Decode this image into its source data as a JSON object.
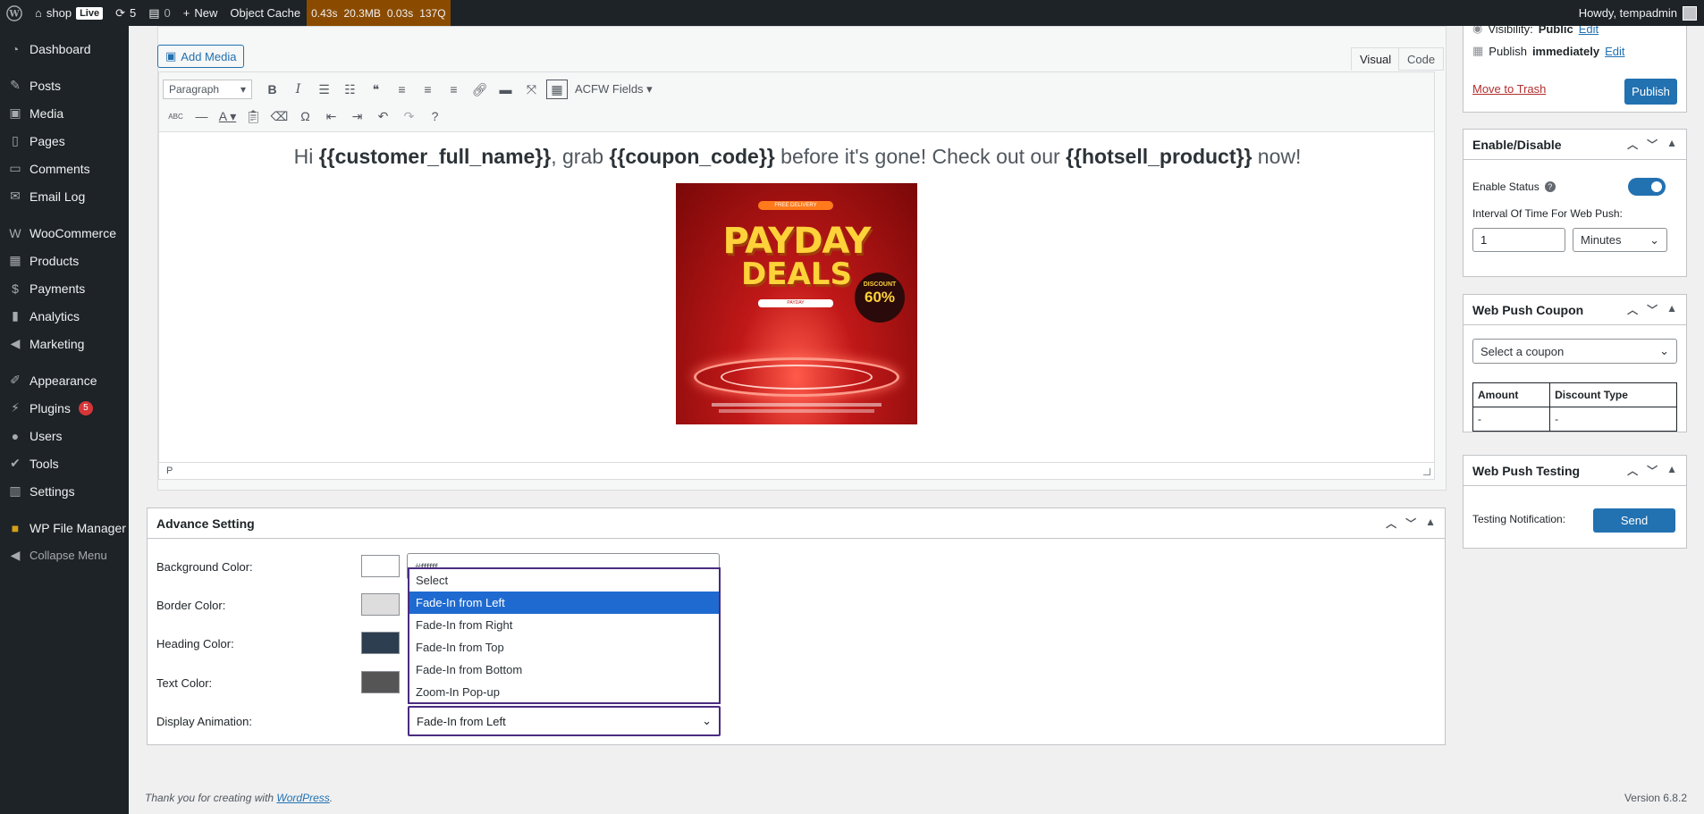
{
  "adminbar": {
    "site_name": "shop",
    "live_badge": "Live",
    "updates_count": "5",
    "comments_count": "0",
    "new_label": "New",
    "object_cache_label": "Object Cache",
    "perf": [
      "0.43s",
      "20.3MB",
      "0.03s",
      "137Q"
    ],
    "howdy": "Howdy, tempadmin"
  },
  "sidebar": {
    "items": [
      {
        "label": "Dashboard",
        "icon": "dashboard-icon"
      },
      {
        "label": "Posts",
        "icon": "pin-icon"
      },
      {
        "label": "Media",
        "icon": "media-icon"
      },
      {
        "label": "Pages",
        "icon": "pages-icon"
      },
      {
        "label": "Comments",
        "icon": "comments-icon"
      },
      {
        "label": "Email Log",
        "icon": "email-icon"
      },
      {
        "label": "WooCommerce",
        "icon": "woocommerce-icon"
      },
      {
        "label": "Products",
        "icon": "products-icon"
      },
      {
        "label": "Payments",
        "icon": "payments-icon"
      },
      {
        "label": "Analytics",
        "icon": "analytics-icon"
      },
      {
        "label": "Marketing",
        "icon": "marketing-icon"
      },
      {
        "label": "Appearance",
        "icon": "appearance-icon"
      },
      {
        "label": "Plugins",
        "icon": "plugins-icon",
        "badge": "5"
      },
      {
        "label": "Users",
        "icon": "users-icon"
      },
      {
        "label": "Tools",
        "icon": "tools-icon"
      },
      {
        "label": "Settings",
        "icon": "settings-icon"
      },
      {
        "label": "WP File Manager",
        "icon": "file-manager-icon"
      },
      {
        "label": "Collapse Menu",
        "icon": "collapse-icon"
      }
    ]
  },
  "editor": {
    "add_media": "Add Media",
    "tab_visual": "Visual",
    "tab_code": "Code",
    "format_select": "Paragraph",
    "acf_fields": "ACFW Fields",
    "content": {
      "t1": "Hi ",
      "b1": "{{customer_full_name}}",
      "t2": ", grab ",
      "b2": "{{coupon_code}}",
      "t3": " before it's gone! Check out our ",
      "b3": "{{hotsell_product}}",
      "t4": " now!"
    },
    "promo_image": {
      "top_text": "FREE DELIVERY",
      "line1": "PAYDAY",
      "line2": "DEALS",
      "discount_label": "DISCOUNT",
      "discount_value": "60%",
      "bar_text": "PAYDAY"
    },
    "status_path": "P"
  },
  "advance": {
    "title": "Advance Setting",
    "labels": {
      "background": "Background Color:",
      "border": "Border Color:",
      "heading": "Heading Color:",
      "text": "Text Color:",
      "animation": "Display Animation:"
    },
    "colors": {
      "background": "#ffffff",
      "border": "#dddddd",
      "heading": "#2c3e50",
      "text": "#555555"
    },
    "hex_value": "#ffffff",
    "animation_selected": "Fade-In from Left",
    "animation_options": [
      "Select",
      "Fade-In from Left",
      "Fade-In from Right",
      "Fade-In from Top",
      "Fade-In from Bottom",
      "Zoom-In Pop-up"
    ]
  },
  "publish": {
    "visibility_label": "Visibility: ",
    "visibility_value": "Public",
    "edit": "Edit",
    "publish_label": "Publish ",
    "publish_value": "immediately",
    "edit2": "Edit",
    "trash": "Move to Trash",
    "publish_button": "Publish"
  },
  "enable": {
    "title": "Enable/Disable",
    "status_label": "Enable Status",
    "interval_label": "Interval Of Time For Web Push:",
    "interval_value": "1",
    "unit": "Minutes"
  },
  "coupon": {
    "title": "Web Push Coupon",
    "select_placeholder": "Select a coupon",
    "headers": [
      "Amount",
      "Discount Type"
    ],
    "row": [
      "-",
      "-"
    ]
  },
  "testing": {
    "title": "Web Push Testing",
    "label": "Testing Notification:",
    "send": "Send"
  },
  "footer": {
    "thanks_prefix": "Thank you for creating with ",
    "wp_link": "WordPress",
    "thanks_suffix": ".",
    "version": "Version 6.8.2"
  }
}
